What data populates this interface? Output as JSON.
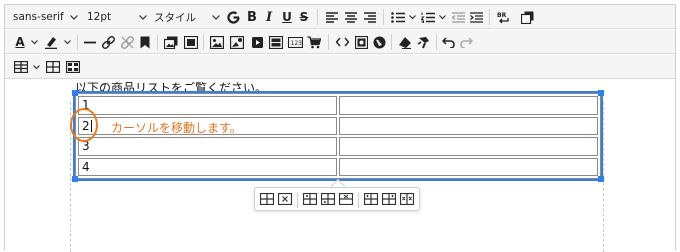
{
  "toolbar": {
    "font_family": "sans-serif",
    "font_size": "12pt",
    "style_label": "スタイル",
    "bold": "B",
    "italic": "I",
    "underline": "U",
    "strikethrough": "S",
    "text_color_letter": "A",
    "colors": {
      "text": "#222222",
      "accent": "#2f80ed",
      "annotation": "#e8731d"
    }
  },
  "content": {
    "paragraph": "以下の商品リストをご覧ください。",
    "table": {
      "rows": [
        [
          "1",
          ""
        ],
        [
          "2",
          ""
        ],
        [
          "3",
          ""
        ],
        [
          "4",
          ""
        ]
      ]
    },
    "annotation": "カーソルを移動します。"
  }
}
